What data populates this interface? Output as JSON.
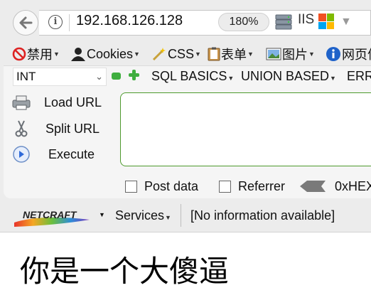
{
  "browser": {
    "url": "192.168.126.128",
    "zoom": "180%",
    "server_label": "IIS"
  },
  "toolbar": {
    "items": [
      {
        "label": "禁用",
        "icon": "no-entry-icon"
      },
      {
        "label": "Cookies",
        "icon": "user-silhouette-icon"
      },
      {
        "label": "CSS",
        "icon": "magic-wand-icon"
      },
      {
        "label": "表单",
        "icon": "clipboard-icon"
      },
      {
        "label": "图片",
        "icon": "image-icon"
      },
      {
        "label": "网页信",
        "icon": "info-circle-icon"
      }
    ]
  },
  "hackbar": {
    "encoding_select": "INT",
    "menus": [
      "SQL BASICS",
      "UNION BASED",
      "ERR"
    ],
    "load_url": "Load URL",
    "split_url": "Split URL",
    "execute": "Execute",
    "textarea_value": "",
    "post_data": "Post data",
    "referrer": "Referrer",
    "hex_label": "0xHEX",
    "post_data_checked": false,
    "referrer_checked": false
  },
  "netcraft": {
    "logo_text": "NETCRAFT",
    "services": "Services",
    "info": "[No information available]"
  },
  "page": {
    "heading": "你是一个大傻逼"
  },
  "colors": {
    "textarea_border": "#4e9a2e",
    "plus_minus": "#3fae3f"
  }
}
